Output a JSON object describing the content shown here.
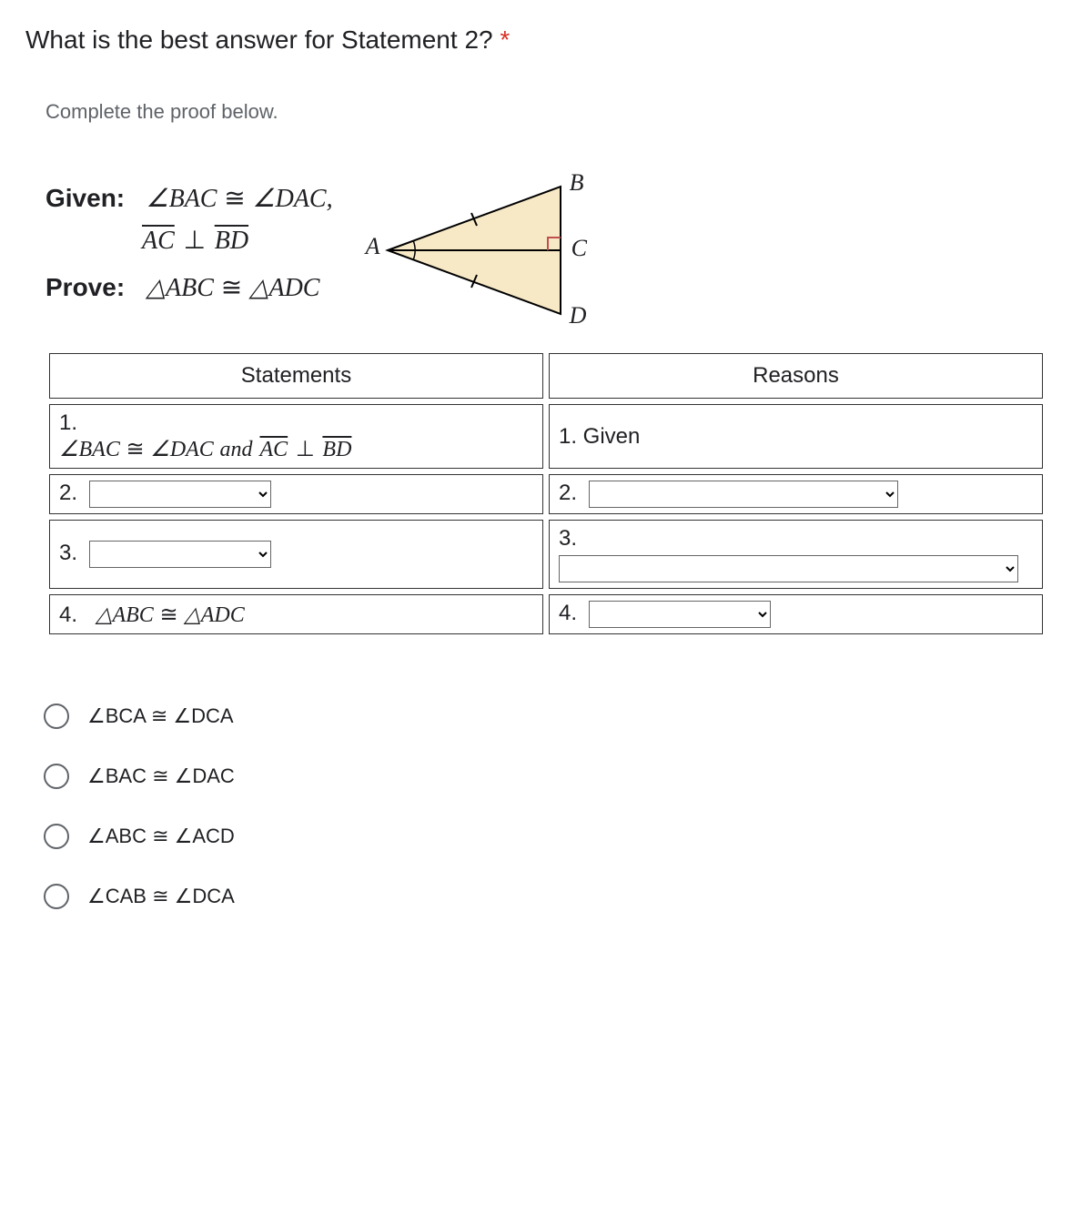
{
  "question": {
    "title": "What is the best answer for Statement 2? ",
    "required_mark": "*",
    "subtitle": "Complete the proof below."
  },
  "problem": {
    "given_label": "Given:",
    "given_line1_a": "∠BAC",
    "given_line1_cong": " ≅ ",
    "given_line1_b": "∠DAC,",
    "given_line2_seg1": "AC",
    "given_line2_perp": " ⊥ ",
    "given_line2_seg2": "BD",
    "prove_label": "Prove:",
    "prove_a": "△ABC",
    "prove_cong": " ≅ ",
    "prove_b": "△ADC"
  },
  "diagram": {
    "A": "A",
    "B": "B",
    "C": "C",
    "D": "D"
  },
  "table": {
    "head_statements": "Statements",
    "head_reasons": "Reasons",
    "s1_num": "1.",
    "s1_a": "∠BAC",
    "s1_cong": " ≅ ",
    "s1_b": "∠DAC",
    "s1_and": " and ",
    "s1_seg1": "AC",
    "s1_perp": " ⊥ ",
    "s1_seg2": "BD",
    "r1": "1.   Given",
    "s2_num": "2.",
    "r2_num": "2.",
    "s3_num": "3.",
    "r3_num": "3.",
    "s4_num": "4.",
    "s4_text_a": "△ABC",
    "s4_cong": " ≅ ",
    "s4_text_b": "△ADC",
    "r4_num": "4."
  },
  "options": {
    "o1": "∠BCA ≅ ∠DCA",
    "o2": "∠BAC ≅ ∠DAC",
    "o3": "∠ABC ≅ ∠ACD",
    "o4": "∠CAB ≅ ∠DCA"
  }
}
